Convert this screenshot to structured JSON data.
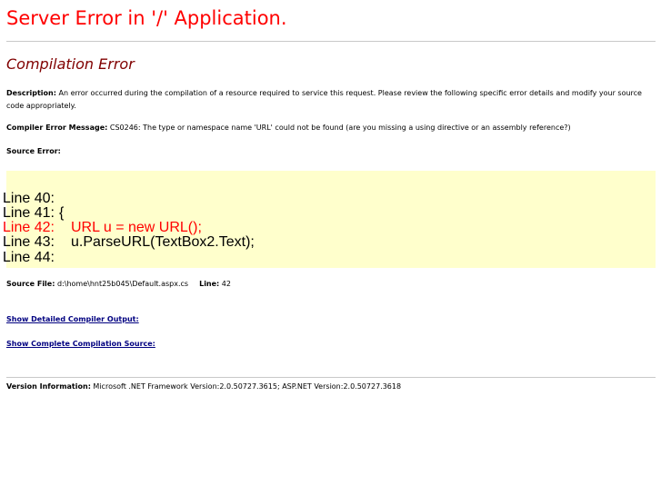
{
  "page": {
    "title": "Server Error in '/' Application.",
    "section_title": "Compilation Error"
  },
  "description": {
    "label": "Description:",
    "text": " An error occurred during the compilation of a resource required to service this request. Please review the following specific error details and modify your source code appropriately."
  },
  "compiler_error": {
    "label": "Compiler Error Message:",
    "text": " CS0246: The type or namespace name 'URL' could not be found (are you missing a using directive or an assembly reference?)"
  },
  "source_error": {
    "label": "Source Error:",
    "lines": [
      {
        "number": "Line 40:",
        "code": ""
      },
      {
        "number": "Line 41:",
        "code": "{"
      },
      {
        "number": "Line 42:",
        "code": "    URL u = new URL();"
      },
      {
        "number": "Line 43:",
        "code": "    u.ParseURL(TextBox2.Text);"
      },
      {
        "number": "Line 44:",
        "code": ""
      }
    ]
  },
  "source_file": {
    "label": "Source File:",
    "path": " d:\\home\\hnt25b045\\Default.aspx.cs",
    "line_label": "Line:",
    "line_value": " 42"
  },
  "links": {
    "detailed_output": "Show Detailed Compiler Output:",
    "complete_source": "Show Complete Compilation Source:"
  },
  "version": {
    "label": "Version Information:",
    "text": " Microsoft .NET Framework Version:2.0.50727.3615; ASP.NET Version:2.0.50727.3618"
  },
  "colors": {
    "title": "#ff0000",
    "section_title": "#800000",
    "code_background": "#ffffcc",
    "error_line": "#ff0000",
    "link": "#000080"
  }
}
